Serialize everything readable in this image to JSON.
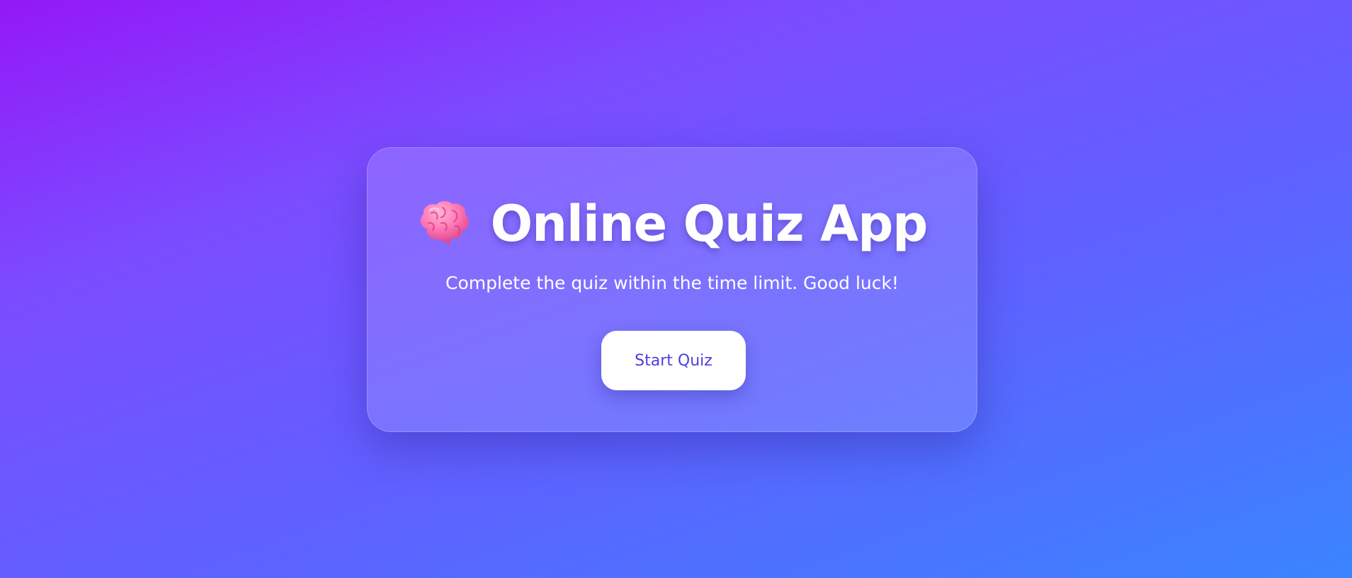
{
  "app": {
    "icon": "brain-icon",
    "title": "Online Quiz App",
    "subtitle": "Complete the quiz within the time limit. Good luck!"
  },
  "actions": {
    "start_label": "Start Quiz"
  },
  "colors": {
    "background_start": "#9418f8",
    "background_end": "#3a84ff",
    "button_background": "#ffffff",
    "button_text": "#4b3fe0",
    "text": "#ffffff",
    "brain_pink": "#ff6fb2"
  }
}
